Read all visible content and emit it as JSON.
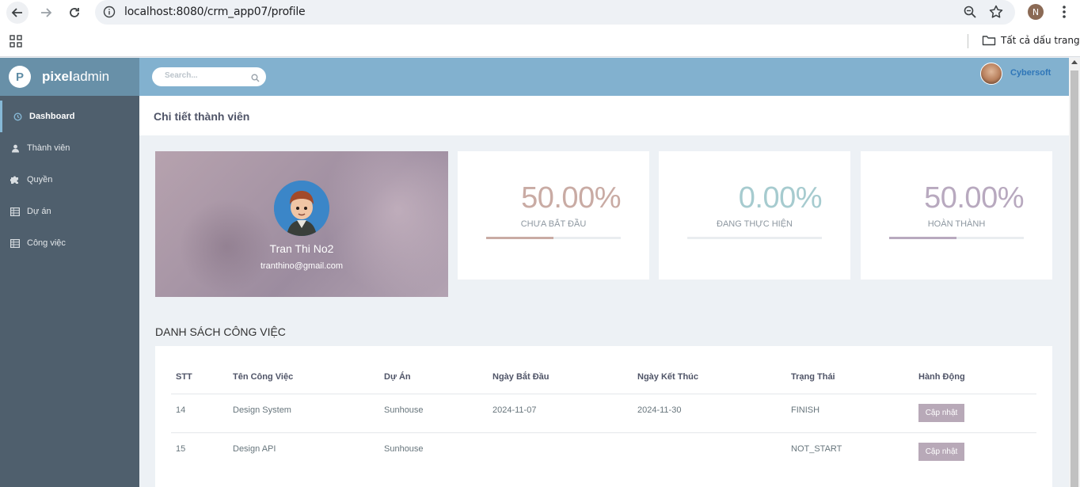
{
  "browser": {
    "url": "localhost:8080/crm_app07/profile",
    "avatar_letter": "N",
    "bookmarks_label": "Tất cả dấu trang"
  },
  "app": {
    "logo_letter": "P",
    "logo_bold": "pixel",
    "logo_light": "admin",
    "search_placeholder": "Search...",
    "user_name": "Cybersoft"
  },
  "sidebar": {
    "items": [
      {
        "label": "Dashboard",
        "icon": "clock-icon",
        "active": true
      },
      {
        "label": "Thành viên",
        "icon": "user-icon"
      },
      {
        "label": "Quyền",
        "icon": "puzzle-icon"
      },
      {
        "label": "Dự án",
        "icon": "table-icon"
      },
      {
        "label": "Công việc",
        "icon": "table-icon"
      }
    ]
  },
  "page": {
    "title": "Chi tiết thành viên"
  },
  "profile": {
    "name": "Tran Thi No2",
    "email": "tranthino@gmail.com"
  },
  "stats": [
    {
      "value": "50.00%",
      "label": "CHƯA BẮT ĐẦU",
      "percent": 50,
      "color": "#c9aba4"
    },
    {
      "value": "0.00%",
      "label": "ĐANG THỰC HIỆN",
      "percent": 0,
      "color": "#a6cbcf"
    },
    {
      "value": "50.00%",
      "label": "HOÀN THÀNH",
      "percent": 50,
      "color": "#b8a9bf"
    }
  ],
  "tasks": {
    "title": "DANH SÁCH CÔNG VIỆC",
    "headers": [
      "STT",
      "Tên Công Việc",
      "Dự Án",
      "Ngày Bắt Đầu",
      "Ngày Kết Thúc",
      "Trạng Thái",
      "Hành Động"
    ],
    "rows": [
      {
        "stt": "14",
        "name": "Design System",
        "project": "Sunhouse",
        "start": "2024-11-07",
        "end": "2024-11-30",
        "status": "FINISH",
        "action": "Cập nhật"
      },
      {
        "stt": "15",
        "name": "Design API",
        "project": "Sunhouse",
        "start": "",
        "end": "",
        "status": "NOT_START",
        "action": "Cập nhật"
      }
    ]
  }
}
